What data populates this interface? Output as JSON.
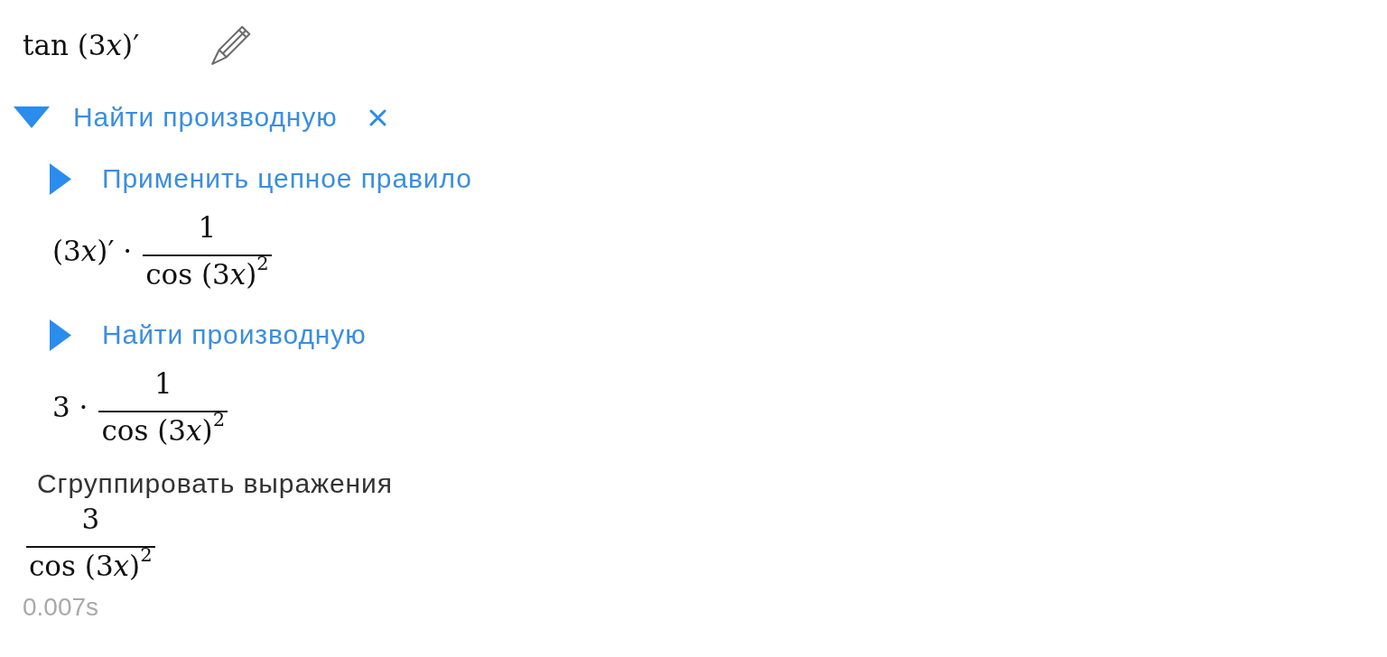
{
  "input": {
    "formula": [
      {
        "kind": "text",
        "text": "tan (3"
      },
      {
        "kind": "var",
        "text": "x"
      },
      {
        "kind": "text",
        "text": ")′"
      }
    ]
  },
  "solution": {
    "title": "Найти производную",
    "expanded": true,
    "children": [
      {
        "title": "Применить цепное правило",
        "expanded": false,
        "result": [
          {
            "kind": "text",
            "text": "(3"
          },
          {
            "kind": "var",
            "text": "x"
          },
          {
            "kind": "text",
            "text": ")′ ·"
          },
          {
            "kind": "fraction",
            "numerator": [
              {
                "kind": "text",
                "text": "1"
              }
            ],
            "denominator": [
              {
                "kind": "text",
                "text": "cos (3"
              },
              {
                "kind": "var",
                "text": "x"
              },
              {
                "kind": "text",
                "text": ")"
              },
              {
                "kind": "sup",
                "text": "2"
              }
            ]
          }
        ]
      },
      {
        "title": "Найти производную",
        "expanded": false,
        "result": [
          {
            "kind": "text",
            "text": "3 ·"
          },
          {
            "kind": "fraction",
            "numerator": [
              {
                "kind": "text",
                "text": "1"
              }
            ],
            "denominator": [
              {
                "kind": "text",
                "text": "cos (3"
              },
              {
                "kind": "var",
                "text": "x"
              },
              {
                "kind": "text",
                "text": ")"
              },
              {
                "kind": "sup",
                "text": "2"
              }
            ]
          }
        ]
      }
    ]
  },
  "final_step": {
    "title": "Сгруппировать выражения",
    "result": [
      {
        "kind": "fraction",
        "numerator": [
          {
            "kind": "text",
            "text": "3"
          }
        ],
        "denominator": [
          {
            "kind": "text",
            "text": "cos (3"
          },
          {
            "kind": "var",
            "text": "x"
          },
          {
            "kind": "text",
            "text": ")"
          },
          {
            "kind": "sup",
            "text": "2"
          }
        ]
      }
    ]
  },
  "timing": "0.007s"
}
